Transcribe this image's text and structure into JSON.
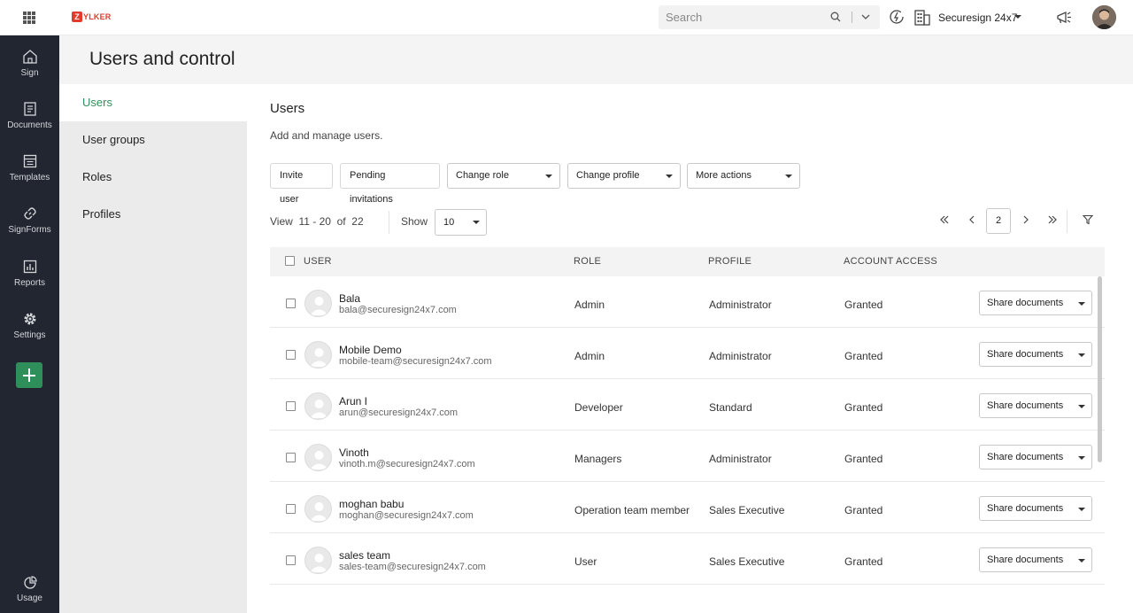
{
  "topbar": {
    "logo_mark": "Z",
    "logo_text": "YLKER",
    "search_placeholder": "Search",
    "org_name": "Securesign 24x7"
  },
  "leftnav": {
    "items": [
      {
        "label": "Sign",
        "icon": "home-icon"
      },
      {
        "label": "Documents",
        "icon": "documents-icon"
      },
      {
        "label": "Templates",
        "icon": "templates-icon"
      },
      {
        "label": "SignForms",
        "icon": "link-icon"
      },
      {
        "label": "Reports",
        "icon": "reports-icon"
      },
      {
        "label": "Settings",
        "icon": "gear-icon"
      }
    ],
    "usage_label": "Usage"
  },
  "page": {
    "title": "Users and control"
  },
  "subnav": {
    "items": [
      "Users",
      "User groups",
      "Roles",
      "Profiles"
    ],
    "active": "Users"
  },
  "main": {
    "title": "Users",
    "description": "Add and manage users.",
    "actions": {
      "invite": "Invite user",
      "pending": "Pending invitations",
      "change_role": "Change role",
      "change_profile": "Change profile",
      "more_actions": "More actions"
    },
    "pagination": {
      "view_range": "View  11 - 20  of  22",
      "show_label": "Show",
      "page_size": "10",
      "current_page": "2"
    },
    "table": {
      "columns": {
        "user": "USER",
        "role": "ROLE",
        "profile": "PROFILE",
        "access": "ACCOUNT ACCESS"
      },
      "action_label": "Share documents",
      "rows": [
        {
          "name": "Bala",
          "email": "bala@securesign24x7.com",
          "role": "Admin",
          "profile": "Administrator",
          "access": "Granted"
        },
        {
          "name": "Mobile Demo",
          "email": "mobile-team@securesign24x7.com",
          "role": "Admin",
          "profile": "Administrator",
          "access": "Granted"
        },
        {
          "name": "Arun I",
          "email": "arun@securesign24x7.com",
          "role": "Developer",
          "profile": "Standard",
          "access": "Granted"
        },
        {
          "name": "Vinoth",
          "email": "vinoth.m@securesign24x7.com",
          "role": "Managers",
          "profile": "Administrator",
          "access": "Granted"
        },
        {
          "name": "moghan babu",
          "email": "moghan@securesign24x7.com",
          "role": "Operation team member",
          "profile": "Sales Executive",
          "access": "Granted"
        },
        {
          "name": "sales team",
          "email": "sales-team@securesign24x7.com",
          "role": "User",
          "profile": "Sales Executive",
          "access": "Granted"
        }
      ]
    }
  },
  "colors": {
    "accent": "#2f8f5b",
    "nav_bg": "#212630",
    "logo": "#e23b2e"
  }
}
